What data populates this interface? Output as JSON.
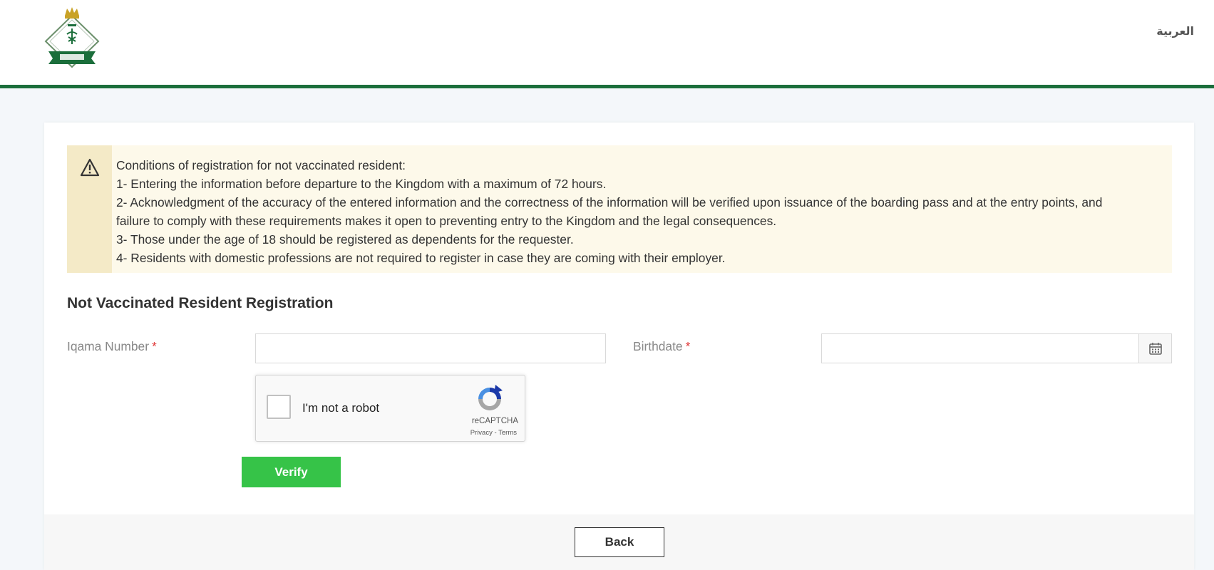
{
  "header": {
    "language_link": "العربية"
  },
  "alert": {
    "lines": [
      "Conditions of registration for not vaccinated resident:",
      "1- Entering the information before departure to the Kingdom with a maximum of 72 hours.",
      "2- Acknowledgment of the accuracy of the entered information and the correctness of the information will be verified upon issuance of the boarding pass and at the entry points, and",
      "failure to comply with these requirements makes it open to preventing entry to the Kingdom and the legal consequences.",
      "3- Those under the age of 18 should be registered as dependents for the requester.",
      "4- Residents with domestic professions are not required to register in case they are coming with their employer."
    ]
  },
  "form": {
    "title": "Not Vaccinated Resident Registration",
    "iqama_label": "Iqama Number",
    "birthdate_label": "Birthdate",
    "required_mark": "*",
    "iqama_value": "",
    "birthdate_value": ""
  },
  "recaptcha": {
    "label": "I'm not a robot",
    "brand": "reCAPTCHA",
    "privacy": "Privacy",
    "separator": " - ",
    "terms": "Terms"
  },
  "buttons": {
    "verify": "Verify",
    "back": "Back"
  },
  "colors": {
    "header_border": "#1b6e3b",
    "verify_bg": "#36c348",
    "alert_bg": "#fdf9ea",
    "required": "#e03a3a"
  }
}
